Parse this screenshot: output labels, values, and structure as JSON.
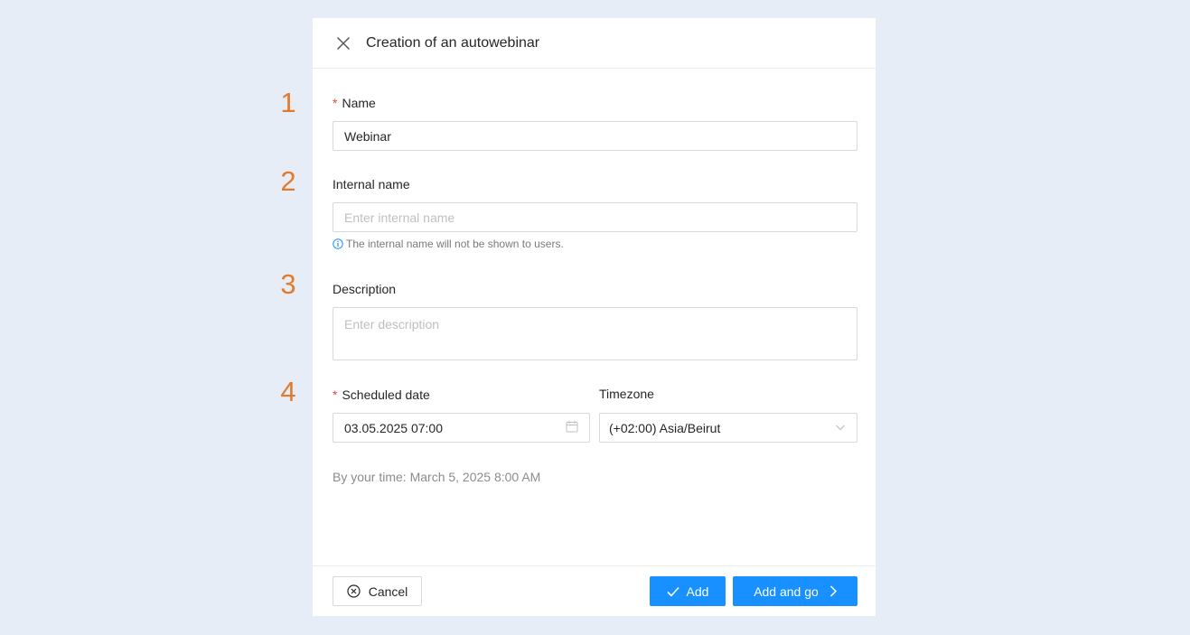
{
  "steps": [
    "1",
    "2",
    "3",
    "4"
  ],
  "modal": {
    "title": "Creation of an autowebinar"
  },
  "form": {
    "name": {
      "required_mark": "*",
      "label": "Name",
      "value": "Webinar"
    },
    "internal_name": {
      "label": "Internal name",
      "placeholder": "Enter internal name",
      "hint": "The internal name will not be shown to users."
    },
    "description": {
      "label": "Description",
      "placeholder": "Enter description"
    },
    "scheduled_date": {
      "required_mark": "*",
      "label": "Scheduled date",
      "value": "03.05.2025 07:00"
    },
    "timezone": {
      "label": "Timezone",
      "value": "(+02:00) Asia/Beirut"
    },
    "by_your_time": "By your time: March 5, 2025 8:00 AM"
  },
  "footer": {
    "cancel_label": "Cancel",
    "add_label": "Add",
    "add_and_go_label": "Add and go"
  },
  "colors": {
    "primary": "#1890ff",
    "step_number": "#e47a2c",
    "required": "#e5483a",
    "background": "#e6edf6"
  },
  "icons": {
    "close": "close-icon",
    "info": "info-icon",
    "calendar": "calendar-icon",
    "dropdown": "chevron-down-icon",
    "cancel": "close-circle-icon",
    "add": "check-icon",
    "add_and_go": "chevron-right-icon"
  }
}
